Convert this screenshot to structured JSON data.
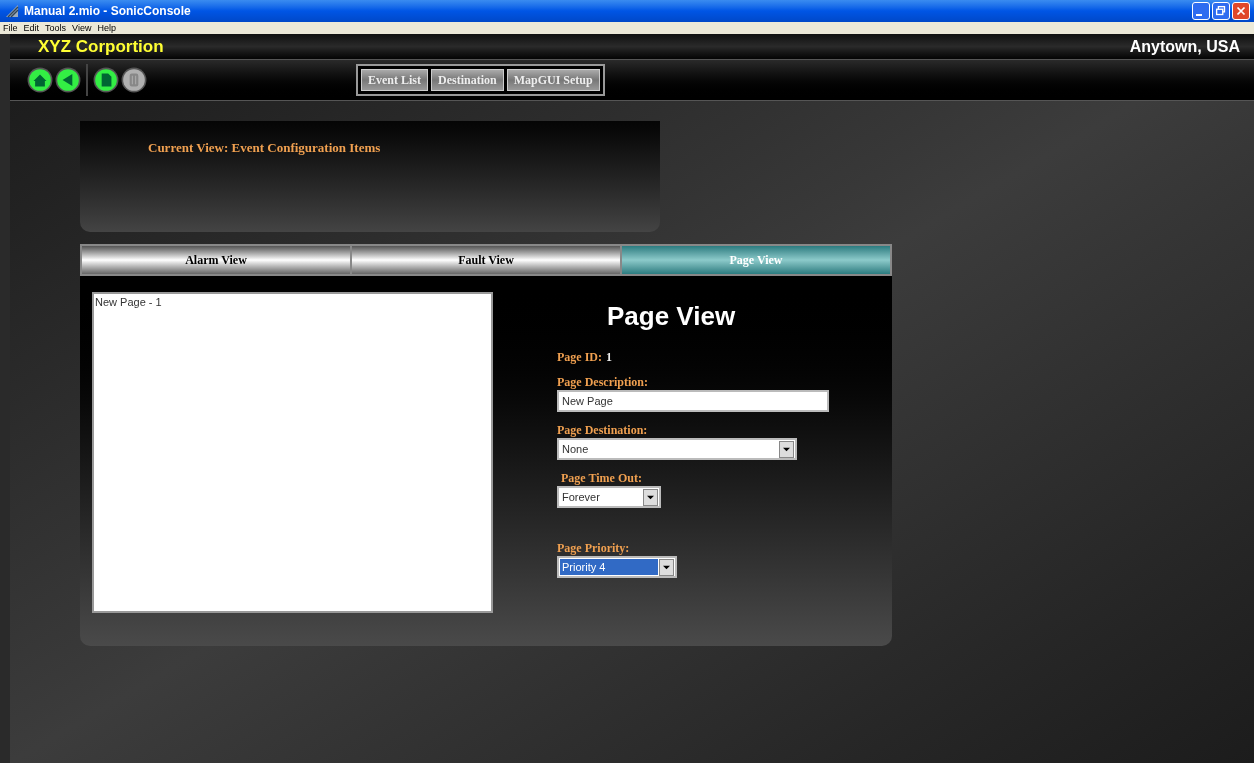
{
  "window": {
    "title": "Manual 2.mio - SonicConsole"
  },
  "menu": [
    "File",
    "Edit",
    "Tools",
    "View",
    "Help"
  ],
  "header": {
    "company": "XYZ Corportion",
    "location": "Anytown, USA"
  },
  "toolbar_icons": [
    {
      "kind": "home",
      "disabled": false
    },
    {
      "kind": "back",
      "disabled": false
    },
    {
      "kind": "page",
      "disabled": false
    },
    {
      "kind": "bin",
      "disabled": true
    }
  ],
  "nav_buttons": [
    "Event List",
    "Destination",
    "MapGUI Setup"
  ],
  "current_view": "Current View: Event Configuration Items",
  "tabs": [
    {
      "label": "Alarm View",
      "selected": false
    },
    {
      "label": "Fault View",
      "selected": false
    },
    {
      "label": "Page View",
      "selected": true
    }
  ],
  "page_list": [
    "New Page - 1"
  ],
  "form": {
    "heading": "Page View",
    "id_label": "Page ID:",
    "id_value": "1",
    "fields": [
      {
        "kind": "text",
        "label": "Page Description:",
        "value": "New Page",
        "highlighted": false
      },
      {
        "kind": "select",
        "label": "Page Destination:",
        "value": "None",
        "highlighted": false
      },
      {
        "kind": "select",
        "label": "Page Time Out:",
        "value": "Forever",
        "highlighted": false
      },
      {
        "kind": "select",
        "label": "Page Priority:",
        "value": "Priority 4",
        "highlighted": true
      }
    ]
  }
}
